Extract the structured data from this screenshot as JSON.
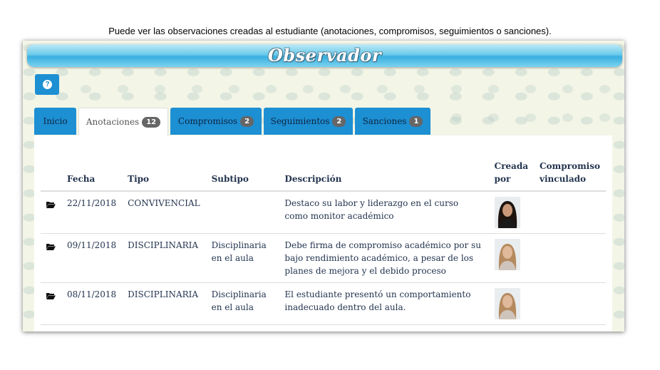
{
  "caption": "Puede ver las observaciones creadas al estudiante (anotaciones, compromisos, seguimientos o sanciones).",
  "window": {
    "title": "Observador"
  },
  "toolbar": {
    "help_icon": "question-circle-icon"
  },
  "tabs": [
    {
      "label": "Inicio",
      "badge": "",
      "active": false
    },
    {
      "label": "Anotaciones",
      "badge": "12",
      "active": true
    },
    {
      "label": "Compromisos",
      "badge": "2",
      "active": false
    },
    {
      "label": "Seguimientos",
      "badge": "2",
      "active": false
    },
    {
      "label": "Sanciones",
      "badge": "1",
      "active": false
    }
  ],
  "table": {
    "headers": {
      "fecha": "Fecha",
      "tipo": "Tipo",
      "subtipo": "Subtipo",
      "descripcion": "Descripción",
      "creada_1": "Creada",
      "creada_2": "por",
      "compromiso_1": "Compromiso",
      "compromiso_2": "vinculado"
    },
    "rows": [
      {
        "icon": "folder-open-icon",
        "fecha": "22/11/2018",
        "tipo": "CONVIVENCIAL",
        "subtipo": "",
        "descripcion": "Destaco su labor y liderazgo en el curso como monitor académico",
        "compromiso": ""
      },
      {
        "icon": "folder-open-icon",
        "fecha": "09/11/2018",
        "tipo": "DISCIPLINARIA",
        "subtipo": "Disciplinaria en el aula",
        "descripcion": "Debe firma de compromiso académico por su bajo rendimiento académico, a pesar de los planes de mejora y el debido proceso",
        "compromiso": ""
      },
      {
        "icon": "folder-open-icon",
        "fecha": "08/11/2018",
        "tipo": "DISCIPLINARIA",
        "subtipo": "Disciplinaria en el aula",
        "descripcion": "El estudiante presentó un comportamiento inadecuado dentro del aula.",
        "compromiso": ""
      }
    ]
  },
  "colors": {
    "tab_blue": "#1d8fd3",
    "text": "#23344f",
    "title_bar": "#39afe0"
  }
}
